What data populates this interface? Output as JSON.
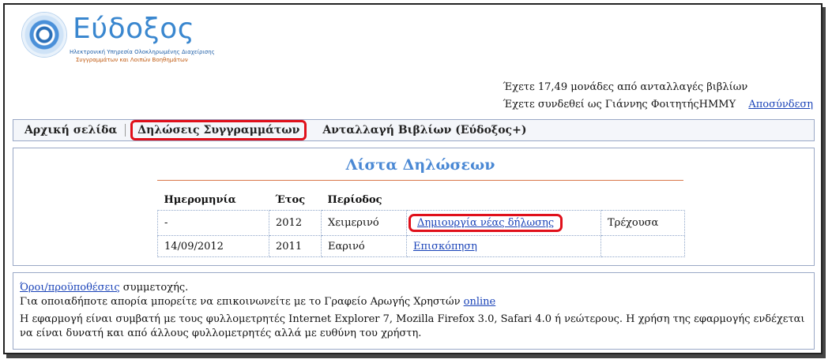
{
  "logo": {
    "name": "Εύδοξος",
    "subtitle_line1": "Ηλεκτρονική Υπηρεσία Ολοκληρωμένης Διαχείρισης",
    "subtitle_line2": "Συγγραμμάτων και Λοιπών Βοηθημάτων"
  },
  "user": {
    "credits_text": "Έχετε 17,49 μονάδες από ανταλλαγές βιβλίων",
    "logged_in_text": "Έχετε συνδεθεί ως Γιάννης ΦοιτητήςΗΜΜΥ",
    "logout_label": "Αποσύνδεση"
  },
  "nav": {
    "home": "Αρχική σελίδα",
    "declarations": "Δηλώσεις Συγγραμμάτων",
    "exchange": "Ανταλλαγή Βιβλίων (Εύδοξος+)"
  },
  "declarations": {
    "title": "Λίστα Δηλώσεων",
    "headers": {
      "date": "Ημερομηνία",
      "year": "Έτος",
      "period": "Περίοδος",
      "action": "",
      "status": ""
    },
    "rows": [
      {
        "date": "-",
        "year": "2012",
        "period": "Χειμερινό",
        "action": "Δημιουργία νέας δήλωσης",
        "status": "Τρέχουσα"
      },
      {
        "date": "14/09/2012",
        "year": "2011",
        "period": "Εαρινό",
        "action": "Επισκόπηση",
        "status": ""
      }
    ]
  },
  "footer": {
    "terms_link": "Όροι/προϋποθέσεις",
    "terms_suffix": " συμμετοχής.",
    "help_text": "Για οποιαδήποτε απορία μπορείτε να επικοινωνείτε με το Γραφείο Αρωγής Χρηστών ",
    "help_link": "online",
    "compat_text": "Η εφαρμογή είναι συμβατή με τους φυλλομετρητές Internet Explorer 7, Mozilla Firefox 3.0, Safari 4.0 ή νεώτερους. Η χρήση της εφαρμογής ενδέχεται να είναι δυνατή και από άλλους φυλλομετρητές αλλά με ευθύνη του χρήστη."
  }
}
